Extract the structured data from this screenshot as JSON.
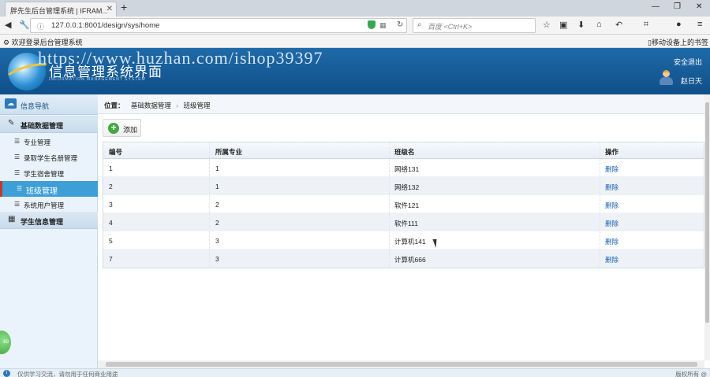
{
  "browser": {
    "tab_title": "胖先生后台管理系统 | IFRAM...",
    "url": "127.0.0.1:8001/design/sys/home",
    "search_placeholder": "百度 <Ctrl+K>",
    "bookmark": "欢迎登录后台管理系统",
    "bookmark_right": "移动设备上的书签"
  },
  "header": {
    "title": "信息管理系统界面",
    "subtitle": "INFORMATION MANAGEMENT SYSTEM",
    "watermark": "https://www.huzhan.com/ishop39397",
    "logout": "安全退出",
    "username": "赵日天"
  },
  "sidebar": {
    "title": "信息导航",
    "groups": [
      {
        "label": "基础数据管理"
      },
      {
        "label": "学生信息管理"
      }
    ],
    "items": [
      {
        "label": "专业管理"
      },
      {
        "label": "录取学生名册管理"
      },
      {
        "label": "学生宿舍管理"
      },
      {
        "label": "班级管理"
      },
      {
        "label": "系统用户管理"
      }
    ],
    "badge": "69"
  },
  "breadcrumb": {
    "label": "位置：",
    "path1": "基础数据管理",
    "sep": "›",
    "path2": "班级管理"
  },
  "toolbar": {
    "add_label": "添加"
  },
  "table": {
    "headers": [
      "编号",
      "所属专业",
      "班级名",
      "操作"
    ],
    "rows": [
      {
        "id": "1",
        "major": "1",
        "name": "网络131",
        "action": "删除"
      },
      {
        "id": "2",
        "major": "1",
        "name": "网络132",
        "action": "删除"
      },
      {
        "id": "3",
        "major": "2",
        "name": "软件121",
        "action": "删除"
      },
      {
        "id": "4",
        "major": "2",
        "name": "软件111",
        "action": "删除"
      },
      {
        "id": "5",
        "major": "3",
        "name": "计算机141",
        "action": "删除"
      },
      {
        "id": "7",
        "major": "3",
        "name": "计算机666",
        "action": "删除"
      }
    ]
  },
  "status": {
    "text": "仅供学习交流，请勿用于任何商业用途",
    "copyright": "版权所有 @"
  }
}
